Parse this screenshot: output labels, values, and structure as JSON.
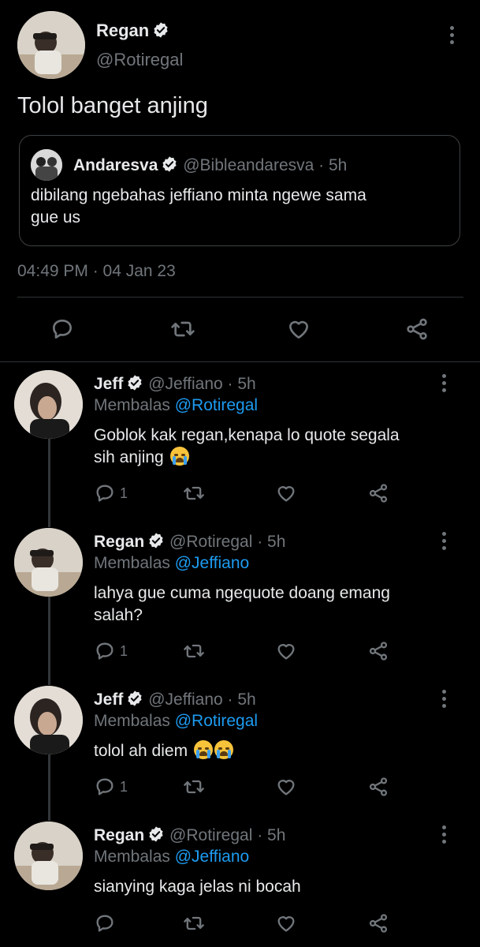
{
  "main_tweet": {
    "name": "Regan",
    "handle": "@Rotiregal",
    "text": "Tolol banget anjing",
    "timestamp": "04:49 PM · 04 Jan 23",
    "quoted": {
      "name": "Andaresva",
      "handle": "@Bibleandaresva",
      "time": "· 5h",
      "text_line1": "dibilang ngebahas jeffiano minta ngewe sama",
      "text_line2": "gue us"
    }
  },
  "replies": [
    {
      "name": "Jeff",
      "handle": "@Jeffiano",
      "time": "· 5h",
      "replying_label": "Membalas",
      "replying_to": "@Rotiregal",
      "text_line1": "Goblok kak regan,kenapa lo quote segala",
      "text_line2": "sih anjing",
      "reply_count": "1"
    },
    {
      "name": "Regan",
      "handle": "@Rotiregal",
      "time": "· 5h",
      "replying_label": "Membalas",
      "replying_to": "@Jeffiano",
      "text_line1": "lahya gue cuma ngequote doang emang",
      "text_line2": "salah?",
      "reply_count": "1"
    },
    {
      "name": "Jeff",
      "handle": "@Jeffiano",
      "time": "· 5h",
      "replying_label": "Membalas",
      "replying_to": "@Rotiregal",
      "text_line1": "tolol ah diem",
      "reply_count": "1"
    },
    {
      "name": "Regan",
      "handle": "@Rotiregal",
      "time": "· 5h",
      "replying_label": "Membalas",
      "replying_to": "@Jeffiano",
      "text_line1": "sianying kaga jelas ni bocah",
      "reply_count": ""
    }
  ],
  "icons": {
    "reply": "comment-icon",
    "retweet": "retweet-icon",
    "like": "heart-icon",
    "share": "share-icon",
    "more": "more-vertical-icon",
    "verified": "verified-badge-icon",
    "emoji": "loudly-crying-face-emoji"
  },
  "colors": {
    "background": "#000000",
    "text": "#e7e9ea",
    "muted": "#71767b",
    "link": "#1d9bf0"
  }
}
